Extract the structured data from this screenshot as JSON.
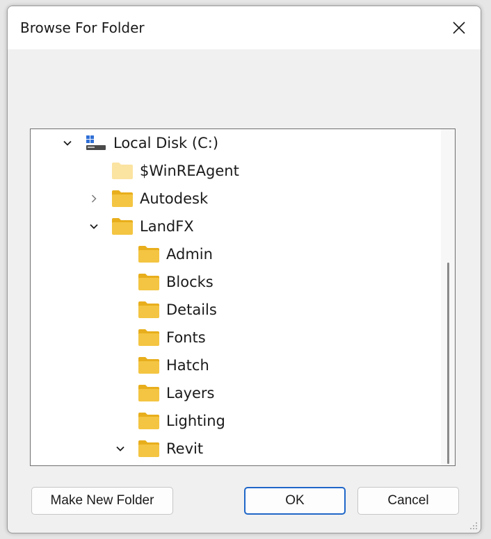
{
  "window": {
    "title": "Browse For Folder",
    "instruction": ""
  },
  "icons": {
    "close": "close-icon",
    "expanded": "chevron-down-icon",
    "collapsed": "chevron-right-icon",
    "folder": "folder-icon",
    "drive": "drive-icon"
  },
  "colors": {
    "folder_body": "#f4c542",
    "folder_tab": "#e8ae1c",
    "folder_light": "#fbe3a1",
    "accent": "#1e66c8"
  },
  "tree": {
    "items": [
      {
        "label": "Local Disk (C:)",
        "state": "expanded",
        "icon": "drive"
      },
      {
        "label": "$WinREAgent",
        "state": "none",
        "icon": "folder-light"
      },
      {
        "label": "Autodesk",
        "state": "collapsed",
        "icon": "folder"
      },
      {
        "label": "LandFX",
        "state": "expanded",
        "icon": "folder"
      },
      {
        "label": "Admin",
        "state": "none",
        "icon": "folder"
      },
      {
        "label": "Blocks",
        "state": "none",
        "icon": "folder"
      },
      {
        "label": "Details",
        "state": "none",
        "icon": "folder"
      },
      {
        "label": "Fonts",
        "state": "none",
        "icon": "folder"
      },
      {
        "label": "Hatch",
        "state": "none",
        "icon": "folder"
      },
      {
        "label": "Layers",
        "state": "none",
        "icon": "folder"
      },
      {
        "label": "Lighting",
        "state": "none",
        "icon": "folder"
      },
      {
        "label": "Revit",
        "state": "expanded",
        "icon": "folder"
      }
    ]
  },
  "buttons": {
    "make_new_folder": "Make New Folder",
    "ok": "OK",
    "cancel": "Cancel"
  }
}
